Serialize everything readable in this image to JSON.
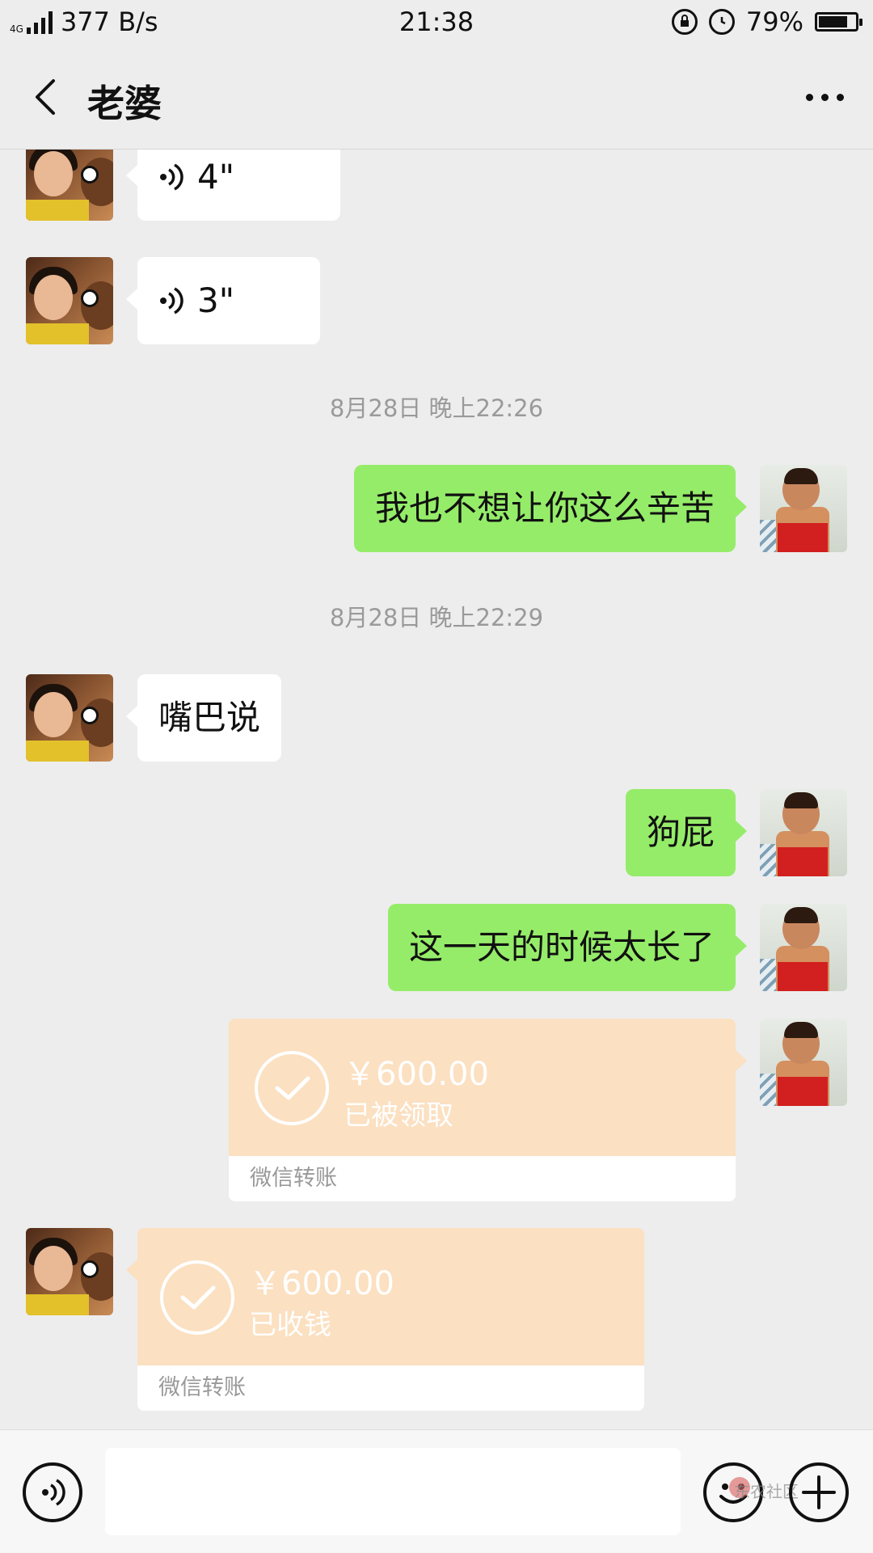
{
  "status_bar": {
    "network_type": "4G",
    "net_speed": "377 B/s",
    "time": "21:38",
    "battery_percent": "79%",
    "battery_level": 0.79
  },
  "header": {
    "title": "老婆"
  },
  "messages": [
    {
      "side": "in",
      "type": "voice",
      "duration": "4\""
    },
    {
      "side": "in",
      "type": "voice",
      "duration": "3\""
    },
    {
      "type": "timestamp",
      "text": "8月28日 晚上22:26"
    },
    {
      "side": "out",
      "type": "text",
      "text": "我也不想让你这么辛苦"
    },
    {
      "type": "timestamp",
      "text": "8月28日 晚上22:29"
    },
    {
      "side": "in",
      "type": "text",
      "text": "嘴巴说"
    },
    {
      "side": "out",
      "type": "text",
      "text": "狗屁"
    },
    {
      "side": "out",
      "type": "text",
      "text": "这一天的时候太长了"
    },
    {
      "side": "out",
      "type": "transfer",
      "amount": "￥600.00",
      "status": "已被领取",
      "label": "微信转账"
    },
    {
      "side": "in",
      "type": "transfer",
      "amount": "￥600.00",
      "status": "已收钱",
      "label": "微信转账"
    }
  ],
  "input_bar": {
    "placeholder": "",
    "watermark": "东农社区"
  },
  "colors": {
    "background": "#ededed",
    "outgoing_bubble": "#95ec69",
    "incoming_bubble": "#ffffff",
    "transfer_card": "#fbe0c1"
  },
  "icons": [
    "signal-icon",
    "lock-rotation-icon",
    "alarm-icon",
    "battery-icon",
    "back-arrow-icon",
    "more-icon",
    "voice-wave-icon",
    "check-icon",
    "voice-input-icon",
    "emoji-icon",
    "plus-icon"
  ]
}
